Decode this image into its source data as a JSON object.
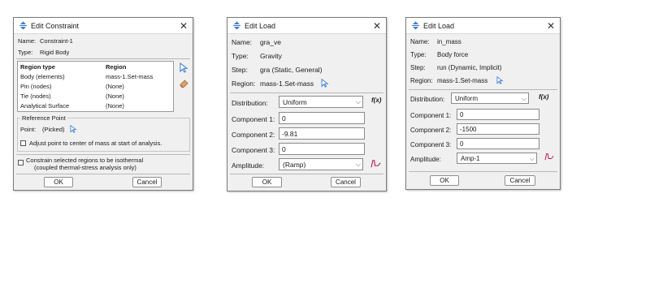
{
  "colors": {
    "accent": "#3a7bd5",
    "amplitude_icon": "#c2185b",
    "dialog_bg": "#f0f0f0"
  },
  "dialog1": {
    "title": "Edit Constraint",
    "name_label": "Name:",
    "name_value": "Constraint-1",
    "type_label": "Type:",
    "type_value": "Rigid Body",
    "table_headers": [
      "Region type",
      "Region"
    ],
    "rows": [
      {
        "type": "Body (elements)",
        "region": "mass-1.Set-mass"
      },
      {
        "type": "Pin (nodes)",
        "region": "(None)"
      },
      {
        "type": "Tie (nodes)",
        "region": "(None)"
      },
      {
        "type": "Analytical Surface",
        "region": "(None)"
      }
    ],
    "ref_group": "Reference Point",
    "point_label": "Point:",
    "point_value": "(Picked)",
    "adjust_label": "Adjust point to center of mass at start of analysis.",
    "isothermal_line1": "Constrain selected regions to be isothermal",
    "isothermal_line2": "(coupled thermal-stress analysis only)",
    "ok": "OK",
    "cancel": "Cancel"
  },
  "dialog2": {
    "title": "Edit Load",
    "name_label": "Name:",
    "name_value": "gra_ve",
    "type_label": "Type:",
    "type_value": "Gravity",
    "step_label": "Step:",
    "step_value": "gra (Static, General)",
    "region_label": "Region:",
    "region_value": "mass-1.Set-mass",
    "distribution_label": "Distribution:",
    "distribution_value": "Uniform",
    "fx": "f(x)",
    "c1_label": "Component 1:",
    "c1_value": "0",
    "c2_label": "Component 2:",
    "c2_value": "-9.81",
    "c3_label": "Component 3:",
    "c3_value": "0",
    "amplitude_label": "Amplitude:",
    "amplitude_value": "(Ramp)",
    "ok": "OK",
    "cancel": "Cancel"
  },
  "dialog3": {
    "title": "Edit Load",
    "name_label": "Name:",
    "name_value": "in_mass",
    "type_label": "Type:",
    "type_value": "Body force",
    "step_label": "Step:",
    "step_value": "run (Dynamic, Implicit)",
    "region_label": "Region:",
    "region_value": "mass-1.Set-mass",
    "distribution_label": "Distribution:",
    "distribution_value": "Uniform",
    "fx": "f(x)",
    "c1_label": "Component 1:",
    "c1_value": "0",
    "c2_label": "Component 2:",
    "c2_value": "-1500",
    "c3_label": "Component 3:",
    "c3_value": "0",
    "amplitude_label": "Amplitude:",
    "amplitude_value": "Amp-1",
    "ok": "OK",
    "cancel": "Cancel"
  }
}
